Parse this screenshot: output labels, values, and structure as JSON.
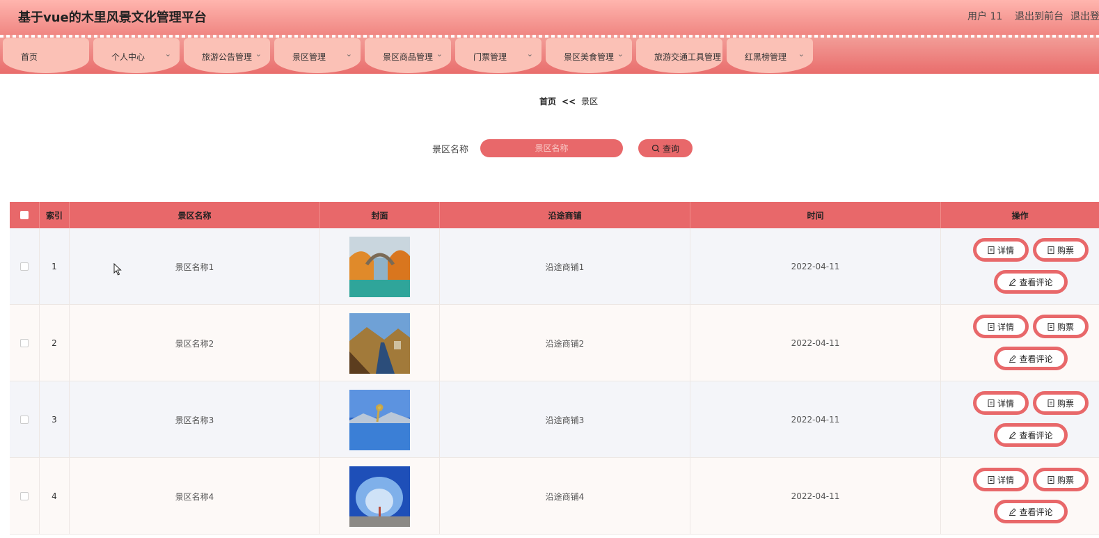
{
  "header": {
    "title": "基于vue的木里风景文化管理平台",
    "user": "用户 11",
    "logout_front": "退出到前台",
    "logout": "退出登录"
  },
  "menu": [
    {
      "label": "首页",
      "dropdown": false
    },
    {
      "label": "个人中心",
      "dropdown": true
    },
    {
      "label": "旅游公告管理",
      "dropdown": true
    },
    {
      "label": "景区管理",
      "dropdown": true
    },
    {
      "label": "景区商品管理",
      "dropdown": true
    },
    {
      "label": "门票管理",
      "dropdown": true
    },
    {
      "label": "景区美食管理",
      "dropdown": true
    },
    {
      "label": "旅游交通工具管理",
      "dropdown": false
    },
    {
      "label": "红黑榜管理",
      "dropdown": true
    }
  ],
  "breadcrumb": {
    "home": "首页",
    "sep": "<<",
    "current": "景区"
  },
  "search": {
    "label": "景区名称",
    "placeholder": "景区名称",
    "button": "查询"
  },
  "table": {
    "headers": {
      "index": "索引",
      "name": "景区名称",
      "cover": "封面",
      "shops": "沿途商铺",
      "time": "时间",
      "ops": "操作"
    },
    "rows": [
      {
        "index": "1",
        "name": "景区名称1",
        "cover": "autumn-bridge",
        "shops": "沿途商铺1",
        "time": "2022-04-11"
      },
      {
        "index": "2",
        "name": "景区名称2",
        "cover": "mountain-road",
        "shops": "沿途商铺2",
        "time": "2022-04-11"
      },
      {
        "index": "3",
        "name": "景区名称3",
        "cover": "lake-tree",
        "shops": "沿途商铺3",
        "time": "2022-04-11"
      },
      {
        "index": "4",
        "name": "景区名称4",
        "cover": "blue-sky-person",
        "shops": "沿途商铺4",
        "time": "2022-04-11"
      }
    ],
    "ops": {
      "detail": "详情",
      "buy": "购票",
      "comments": "查看评论"
    }
  },
  "colors": {
    "accent": "#e8686a",
    "header_top": "#ffb5ae",
    "menu_pill": "#fbc1b6"
  }
}
